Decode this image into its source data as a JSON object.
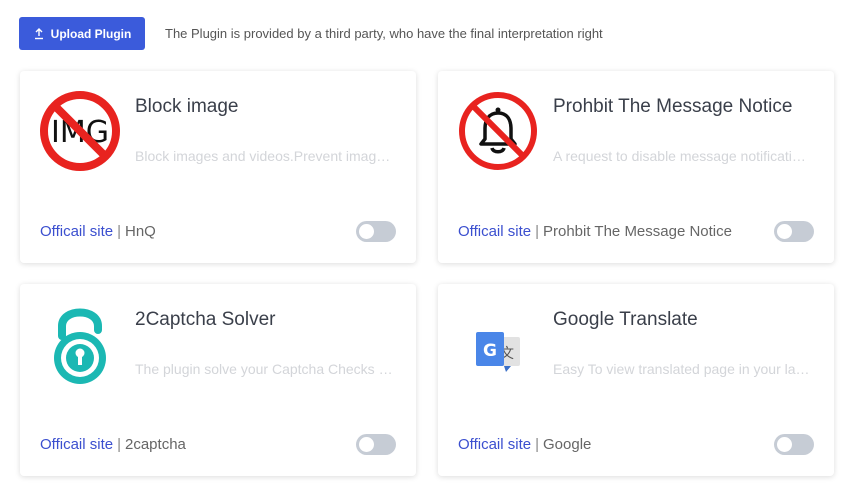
{
  "toolbar": {
    "upload_label": "Upload Plugin",
    "notice": "The Plugin is provided by a third party, who have the final interpretation right"
  },
  "plugins": [
    {
      "title": "Block image",
      "description": "Block images and videos.Prevent images and videos from loading",
      "site_label": "Officail site",
      "separator": "|",
      "author": "HnQ",
      "enabled": false,
      "icon": "block-image-icon",
      "icon_text": "IMG"
    },
    {
      "title": "Prohbit The Message Notice",
      "description": "A request to disable message notifications",
      "site_label": "Officail site",
      "separator": "|",
      "author": "Prohbit The Message Notice",
      "enabled": false,
      "icon": "no-bell-icon"
    },
    {
      "title": "2Captcha Solver",
      "description": "The plugin solve your Captcha Checks automatically",
      "site_label": "Officail site",
      "separator": "|",
      "author": "2captcha",
      "enabled": false,
      "icon": "padlock-icon"
    },
    {
      "title": "Google Translate",
      "description": "Easy To view translated page in your language",
      "site_label": "Officail site",
      "separator": "|",
      "author": "Google",
      "enabled": false,
      "icon": "google-translate-icon"
    }
  ],
  "colors": {
    "primary": "#3b5bdb",
    "link": "#3b4fcf",
    "prohibit_red": "#e8231f",
    "captcha_teal": "#1bb8b3",
    "toggle_off": "#c6ccd5"
  }
}
